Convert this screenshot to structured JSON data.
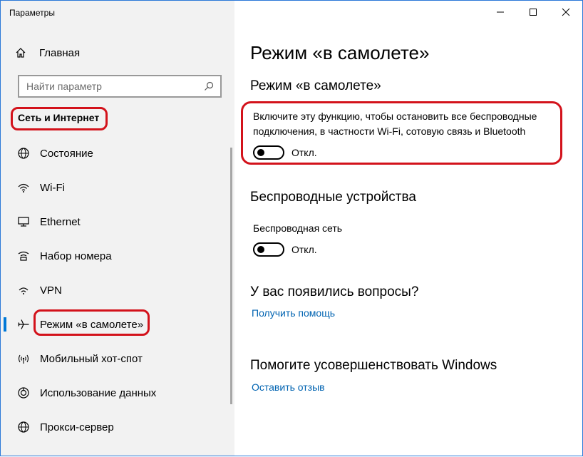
{
  "window": {
    "title": "Параметры",
    "controls": {
      "minimize": "—",
      "maximize": "☐",
      "close": "✕"
    }
  },
  "sidebar": {
    "home_label": "Главная",
    "search_placeholder": "Найти параметр",
    "section_title": "Сеть и Интернет",
    "items": [
      {
        "label": "Состояние",
        "icon": "globe-icon"
      },
      {
        "label": "Wi-Fi",
        "icon": "wifi-icon"
      },
      {
        "label": "Ethernet",
        "icon": "monitor-icon"
      },
      {
        "label": "Набор номера",
        "icon": "dialup-icon"
      },
      {
        "label": "VPN",
        "icon": "vpn-icon"
      },
      {
        "label": "Режим «в самолете»",
        "icon": "airplane-icon",
        "active": true
      },
      {
        "label": "Мобильный хот-спот",
        "icon": "hotspot-icon"
      },
      {
        "label": "Использование данных",
        "icon": "data-usage-icon"
      },
      {
        "label": "Прокси-сервер",
        "icon": "proxy-globe-icon"
      }
    ]
  },
  "main": {
    "page_title": "Режим «в самолете»",
    "airplane": {
      "heading": "Режим «в самолете»",
      "description": "Включите эту функцию, чтобы остановить все беспроводные подключения, в частности Wi-Fi, сотовую связь и Bluetooth",
      "toggle_state": "Откл."
    },
    "wireless": {
      "heading": "Беспроводные устройства",
      "wifi_label": "Беспроводная сеть",
      "toggle_state": "Откл."
    },
    "questions": {
      "heading": "У вас появились вопросы?",
      "link": "Получить помощь"
    },
    "improve": {
      "heading": "Помогите усовершенствовать Windows",
      "link": "Оставить отзыв"
    }
  },
  "colors": {
    "accent": "#0078d7",
    "link": "#0063b1",
    "annotation": "#d3121b",
    "sidebar_bg": "#f2f2f2"
  }
}
